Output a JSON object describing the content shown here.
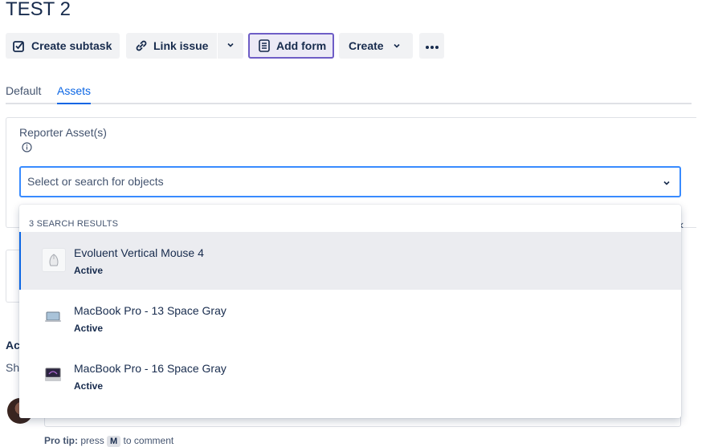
{
  "issue": {
    "title": "TEST 2"
  },
  "toolbar": {
    "create_subtask": "Create subtask",
    "link_issue": "Link issue",
    "add_form": "Add form",
    "create": "Create"
  },
  "tabs": [
    {
      "label": "Default",
      "active": false
    },
    {
      "label": "Assets",
      "active": true
    }
  ],
  "field": {
    "label": "Reporter Asset(s)",
    "placeholder": "Select or search for objects"
  },
  "dropdown": {
    "header": "3 SEARCH RESULTS",
    "options": [
      {
        "name": "Evoluent Vertical Mouse 4",
        "status": "Active",
        "icon": "mouse-icon"
      },
      {
        "name": "MacBook Pro - 13 Space Gray",
        "status": "Active",
        "icon": "laptop-icon"
      },
      {
        "name": "MacBook Pro - 16 Space Gray",
        "status": "Active",
        "icon": "laptop-icon"
      }
    ]
  },
  "background": {
    "activity_partial": "Ac",
    "show_partial": "Sh",
    "pro_tip_label": "Pro tip:",
    "pro_tip_pre": "press",
    "pro_tip_key": "M",
    "pro_tip_post": "to comment"
  },
  "colors": {
    "primary": "#0c66e4",
    "focus_border": "#388bff",
    "add_form_border": "#6e5dc6"
  }
}
